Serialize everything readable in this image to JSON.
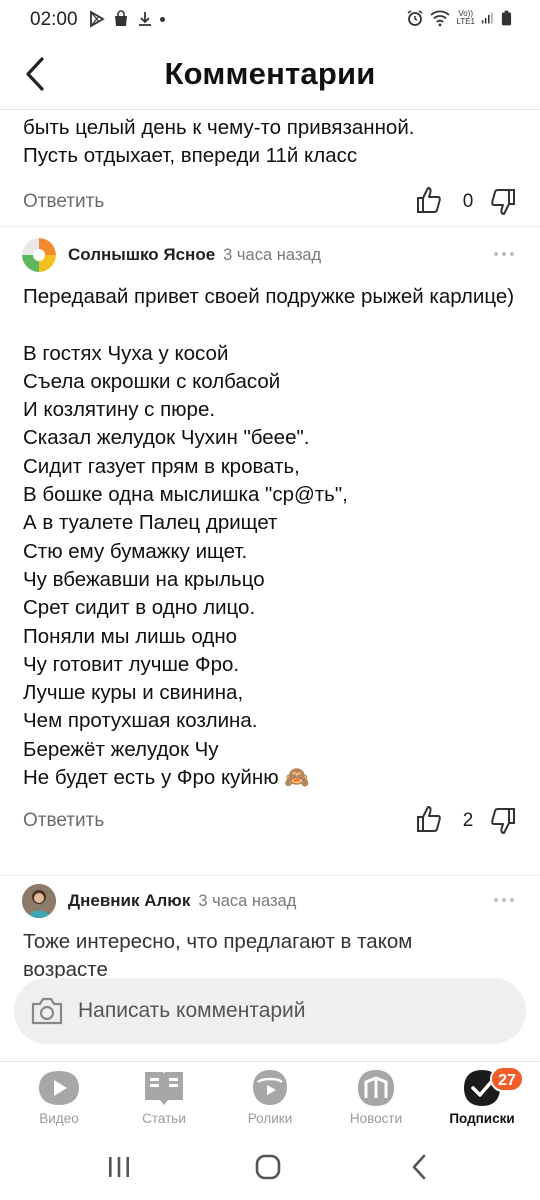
{
  "status_bar": {
    "time": "02:00",
    "lte_top": "Vo))",
    "lte_bottom": "LTE1"
  },
  "header": {
    "title": "Комментарии"
  },
  "comments": [
    {
      "text": "быть целый день к чему-то привязанной.\nПусть отдыхает, впереди 11й класс",
      "reply_label": "Ответить",
      "likes": "0"
    },
    {
      "author": "Солнышко Ясное",
      "time": "3 часа назад",
      "text": "Передавай привет своей подружке рыжей карлице)\n\nВ гостях Чуха у косой\nСъела окрошки с колбасой\nИ козлятину с пюре.\nСказал желудок Чухин \"беее\".\nСидит газует прям в кровать,\nВ бошке одна мыслишка \"ср@ть\",\nА в туалете Палец дрищет\nСтю ему бумажку ищет.\nЧу вбежавши на крыльцо\nСрет сидит в одно лицо.\nПоняли мы лишь одно\nЧу готовит лучше Фро.\nЛучше куры и свинина,\nЧем протухшая козлина.\nБережёт желудок Чу\nНе будет есть у Фро куйню 🙈",
      "reply_label": "Ответить",
      "likes": "2"
    },
    {
      "author": "Дневник Алюк",
      "time": "3 часа назад",
      "text": "Тоже интересно, что предлагают в таком возрасте"
    }
  ],
  "write_comment": {
    "placeholder": "Написать комментарий",
    "icon": "camera-icon"
  },
  "bottom_nav": {
    "items": [
      {
        "label": "Видео",
        "icon": "video-icon"
      },
      {
        "label": "Статьи",
        "icon": "articles-icon"
      },
      {
        "label": "Ролики",
        "icon": "clips-icon"
      },
      {
        "label": "Новости",
        "icon": "news-icon"
      },
      {
        "label": "Подписки",
        "icon": "subscriptions-icon",
        "badge": "27",
        "active": true
      }
    ]
  },
  "colors": {
    "accent": "#f25c2b",
    "text": "#111111",
    "muted": "#6b6b6b",
    "input_bg": "#efefef"
  }
}
